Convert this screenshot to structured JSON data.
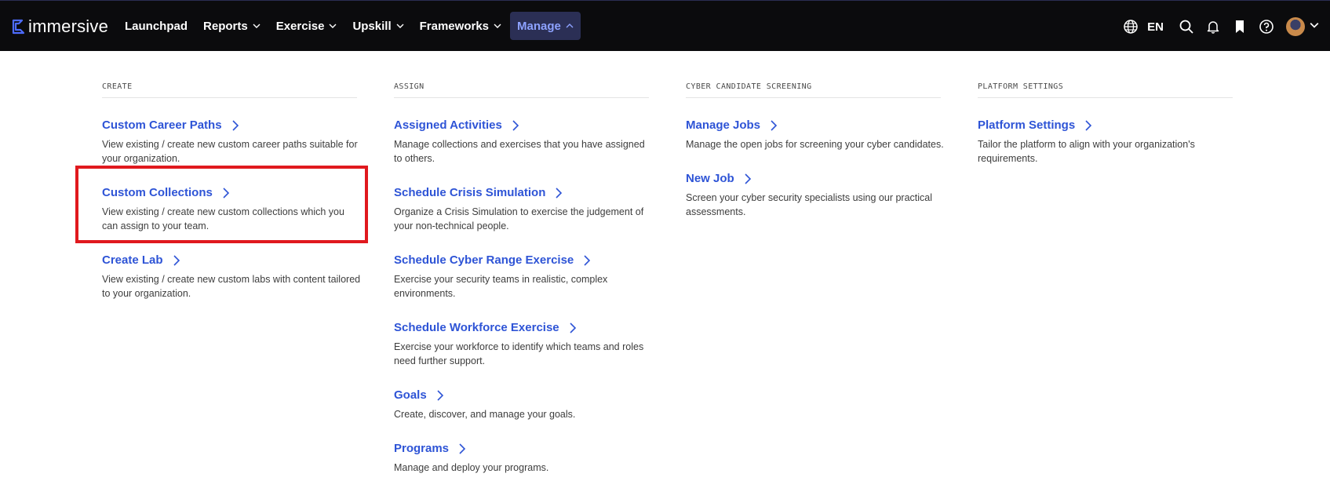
{
  "brand": {
    "name": "immersive"
  },
  "nav": {
    "items": [
      {
        "label": "Launchpad",
        "dropdown": false,
        "active": false
      },
      {
        "label": "Reports",
        "dropdown": true,
        "active": false
      },
      {
        "label": "Exercise",
        "dropdown": true,
        "active": false
      },
      {
        "label": "Upskill",
        "dropdown": true,
        "active": false
      },
      {
        "label": "Frameworks",
        "dropdown": true,
        "active": false
      },
      {
        "label": "Manage",
        "dropdown": true,
        "active": true
      }
    ]
  },
  "header_right": {
    "language": "EN",
    "icons": [
      "globe-icon",
      "search-icon",
      "bell-icon",
      "bookmark-icon",
      "help-icon",
      "avatar",
      "chevron-down-icon"
    ]
  },
  "colors": {
    "topbar": "#0b0b0d",
    "link": "#2e54d6",
    "active_nav_bg": "#2b2f55",
    "active_nav_text": "#8da2ff",
    "highlight": "#e0191e"
  },
  "menu": {
    "columns": [
      {
        "heading": "CREATE",
        "items": [
          {
            "title": "Custom Career Paths",
            "desc": "View existing / create new custom career paths suitable for your organization."
          },
          {
            "title": "Custom Collections",
            "desc": "View existing / create new custom collections which you can assign to your team."
          },
          {
            "title": "Create Lab",
            "desc": "View existing / create new custom labs with content tailored to your organization."
          }
        ]
      },
      {
        "heading": "ASSIGN",
        "items": [
          {
            "title": "Assigned Activities",
            "desc": "Manage collections and exercises that you have assigned to others."
          },
          {
            "title": "Schedule Crisis Simulation",
            "desc": "Organize a Crisis Simulation to exercise the judgement of your non-technical people."
          },
          {
            "title": "Schedule Cyber Range Exercise",
            "desc": "Exercise your security teams in realistic, complex environments."
          },
          {
            "title": "Schedule Workforce Exercise",
            "desc": "Exercise your workforce to identify which teams and roles need further support."
          },
          {
            "title": "Goals",
            "desc": "Create, discover, and manage your goals."
          },
          {
            "title": "Programs",
            "desc": "Manage and deploy your programs."
          }
        ]
      },
      {
        "heading": "CYBER CANDIDATE SCREENING",
        "items": [
          {
            "title": "Manage Jobs",
            "desc": "Manage the open jobs for screening your cyber candidates."
          },
          {
            "title": "New Job",
            "desc": "Screen your cyber security specialists using our practical assessments."
          }
        ]
      },
      {
        "heading": "PLATFORM SETTINGS",
        "items": [
          {
            "title": "Platform Settings",
            "desc": "Tailor the platform to align with your organization's requirements."
          }
        ]
      }
    ]
  }
}
